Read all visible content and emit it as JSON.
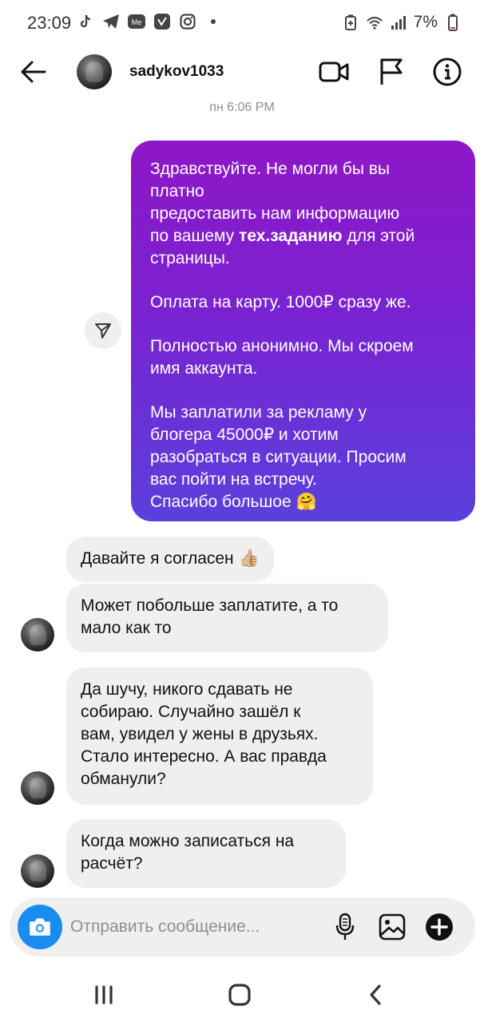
{
  "status_bar": {
    "time": "23:09",
    "battery": "7%",
    "left_icons": [
      "tiktok-icon",
      "telegram-icon",
      "vk-messenger-icon",
      "vk-icon",
      "instagram-icon",
      "dot-icon"
    ],
    "right_icons": [
      "battery-saver-icon",
      "wifi-icon",
      "signal-icon",
      "battery-icon"
    ]
  },
  "header": {
    "username": "sadykov1033",
    "actions": [
      "video-call-icon",
      "flag-icon",
      "info-icon"
    ]
  },
  "timestamp": "пн 6:06 PM",
  "outgoing_message": {
    "line1": "Здравствуйте. Не могли бы вы",
    "line2": "платно",
    "line3": "предоставить нам информацию",
    "line4_before": "по вашему ",
    "line4_bold": "тех.заданию",
    "line4_after": " для этой",
    "line5": "страницы.",
    "para2": "Оплата на карту. 1000₽ сразу же.",
    "para3_line1": "Полностью анонимно. Мы скроем",
    "para3_line2": "имя аккаунта.",
    "para4_line1": "Мы заплатили за рекламу у",
    "para4_line2": "блогера 45000₽ и хотим",
    "para4_line3": "разобраться в ситуации. Просим",
    "para4_line4": "вас пойти на встречу.",
    "para4_line5": "Спасибо большое 🤗"
  },
  "incoming_messages": {
    "m1": "Давайте я согласен 👍🏼",
    "m2_line1": "Может побольше заплатите, а то",
    "m2_line2": "мало как то",
    "m3_line1": "Да шучу, никого сдавать не",
    "m3_line2": "собираю. Случайно зашёл к",
    "m3_line3": "вам, увидел у жены в друзьях.",
    "m3_line4": "Стало интересно. А вас правда",
    "m3_line5": "обманули?",
    "m4_line1": "Когда можно записаться на",
    "m4_line2": "расчёт?"
  },
  "composer": {
    "placeholder": "Отправить сообщение...",
    "camera_color": "#1a8cf0"
  },
  "colors": {
    "bubble_gradient_top": "#8e17c6",
    "bubble_gradient_bottom": "#5a40dc",
    "incoming_bubble": "#efefef"
  }
}
